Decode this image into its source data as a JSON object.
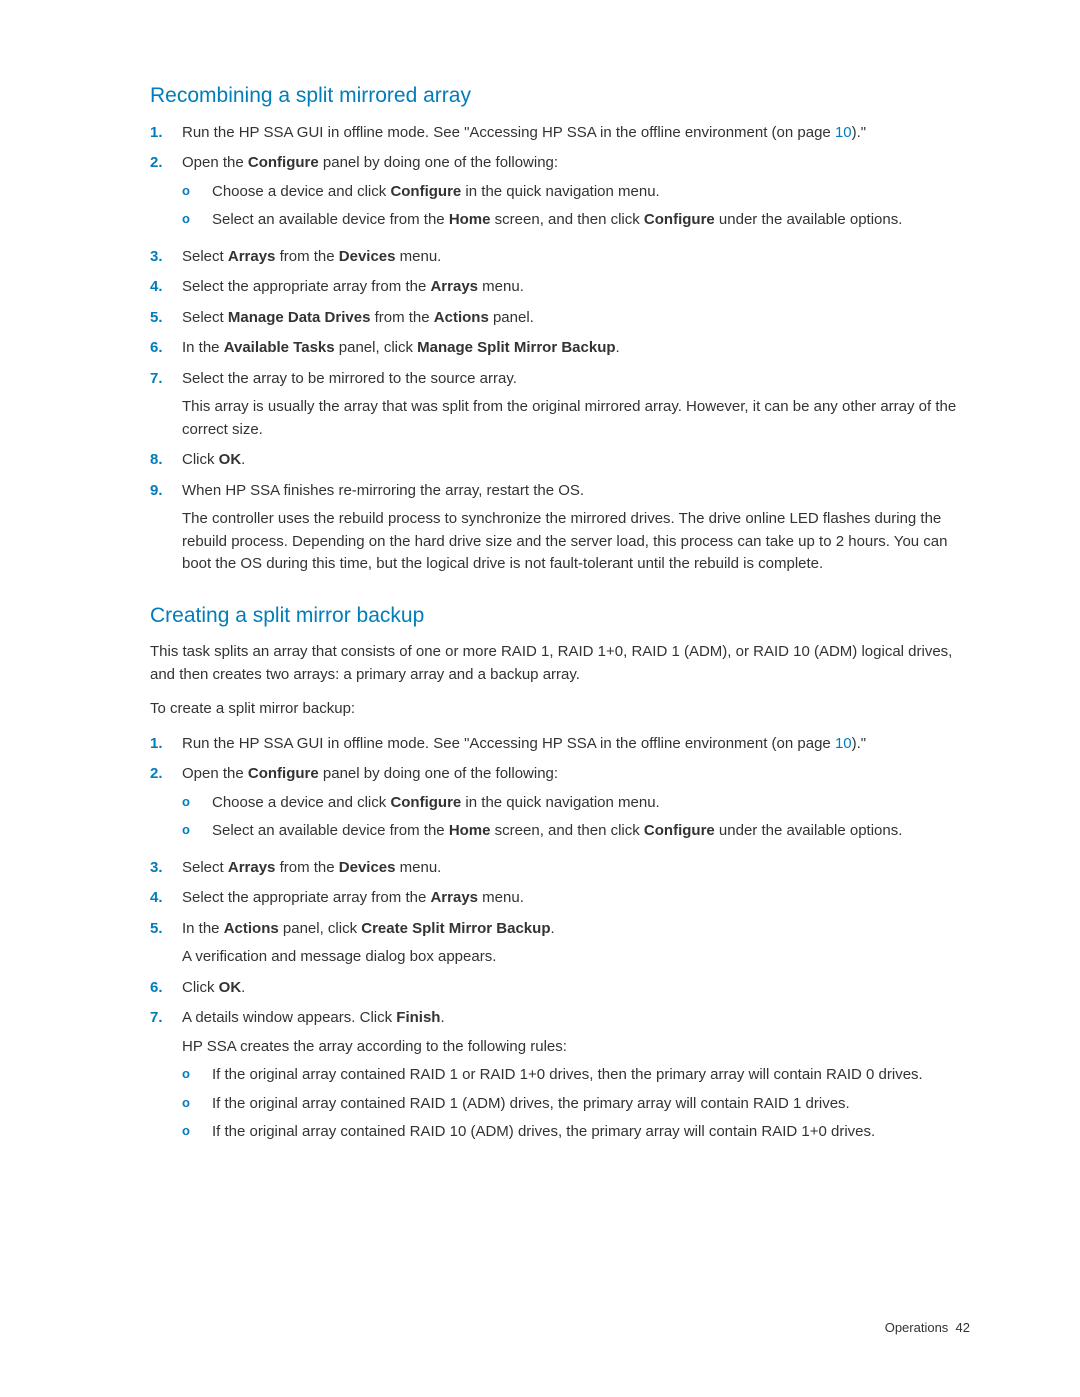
{
  "section1": {
    "title": "Recombining a split mirrored array",
    "steps": [
      {
        "n": "1.",
        "text_before_link": "Run the HP SSA GUI in offline mode. See \"Accessing HP SSA in the offline environment (on page ",
        "link": "10",
        "text_after_link": ").\""
      },
      {
        "n": "2.",
        "text_prefix": "Open the ",
        "bold1": "Configure",
        "text_suffix": " panel by doing one of the following:",
        "sub": [
          {
            "b": "o",
            "pre": "Choose a device and click ",
            "bold": "Configure",
            "post": " in the quick navigation menu."
          },
          {
            "b": "o",
            "pre": "Select an available device from the ",
            "bold": "Home",
            "mid": " screen, and then click ",
            "bold2": "Configure",
            "post": " under the available options."
          }
        ]
      },
      {
        "n": "3.",
        "pre": "Select ",
        "bold1": "Arrays",
        "mid": " from the ",
        "bold2": "Devices",
        "post": " menu."
      },
      {
        "n": "4.",
        "pre": "Select the appropriate array from the ",
        "bold1": "Arrays",
        "post": " menu."
      },
      {
        "n": "5.",
        "pre": "Select ",
        "bold1": "Manage Data Drives",
        "mid": " from the ",
        "bold2": "Actions",
        "post": " panel."
      },
      {
        "n": "6.",
        "pre": "In the ",
        "bold1": "Available Tasks",
        "mid": " panel, click ",
        "bold2": "Manage Split Mirror Backup",
        "post": "."
      },
      {
        "n": "7.",
        "text": "Select the array to be mirrored to the source array.",
        "extra": "This array is usually the array that was split from the original mirrored array. However, it can be any other array of the correct size."
      },
      {
        "n": "8.",
        "pre": "Click ",
        "bold1": "OK",
        "post": "."
      },
      {
        "n": "9.",
        "text": "When HP SSA finishes re-mirroring the array, restart the OS.",
        "extra": "The controller uses the rebuild process to synchronize the mirrored drives. The drive online LED flashes during the rebuild process. Depending on the hard drive size and the server load, this process can take up to 2 hours. You can boot the OS during this time, but the logical drive is not fault-tolerant until the rebuild is complete."
      }
    ]
  },
  "section2": {
    "title": "Creating a split mirror backup",
    "intro1": "This task splits an array that consists of one or more RAID 1, RAID 1+0, RAID 1 (ADM), or RAID 10 (ADM) logical drives, and then creates two arrays: a primary array and a backup array.",
    "intro2": "To create a split mirror backup:",
    "steps": [
      {
        "n": "1.",
        "text_before_link": "Run the HP SSA GUI in offline mode. See \"Accessing HP SSA in the offline environment (on page ",
        "link": "10",
        "text_after_link": ").\""
      },
      {
        "n": "2.",
        "text_prefix": "Open the ",
        "bold1": "Configure",
        "text_suffix": " panel by doing one of the following:",
        "sub": [
          {
            "b": "o",
            "pre": "Choose a device and click ",
            "bold": "Configure",
            "post": " in the quick navigation menu."
          },
          {
            "b": "o",
            "pre": "Select an available device from the ",
            "bold": "Home",
            "mid": " screen, and then click ",
            "bold2": "Configure",
            "post": " under the available options."
          }
        ]
      },
      {
        "n": "3.",
        "pre": "Select ",
        "bold1": "Arrays",
        "mid": " from the ",
        "bold2": "Devices",
        "post": " menu."
      },
      {
        "n": "4.",
        "pre": "Select the appropriate array from the ",
        "bold1": "Arrays",
        "post": " menu."
      },
      {
        "n": "5.",
        "pre": "In the ",
        "bold1": "Actions",
        "mid": " panel, click ",
        "bold2": "Create Split Mirror Backup",
        "post": ".",
        "extra": "A verification and message dialog box appears."
      },
      {
        "n": "6.",
        "pre": "Click ",
        "bold1": "OK",
        "post": "."
      },
      {
        "n": "7.",
        "pre": "A details window appears. Click ",
        "bold1": "Finish",
        "post": ".",
        "extra": "HP SSA creates the array according to the following rules:",
        "sub": [
          {
            "b": "o",
            "text": "If the original array contained RAID 1 or RAID 1+0 drives, then the primary array will contain RAID 0 drives."
          },
          {
            "b": "o",
            "text": "If the original array contained RAID 1 (ADM) drives, the primary array will contain RAID 1 drives."
          },
          {
            "b": "o",
            "text": "If the original array contained RAID 10 (ADM) drives, the primary array will contain RAID 1+0 drives."
          }
        ]
      }
    ]
  },
  "footer": {
    "label": "Operations",
    "page": "42"
  }
}
